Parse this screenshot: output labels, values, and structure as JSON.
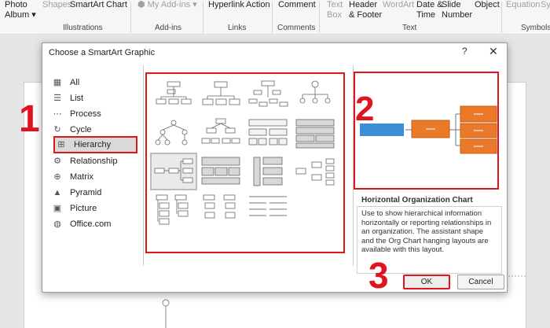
{
  "ribbon": {
    "items": [
      {
        "label": "Photo\nAlbum ▾",
        "dim": false
      },
      {
        "label": "Shapes",
        "dim": true
      },
      {
        "label": "SmartArt",
        "dim": false
      },
      {
        "label": "Chart",
        "dim": false
      },
      {
        "label": "My Add-ins ▾",
        "dim": true
      },
      {
        "label": "Hyperlink",
        "dim": false
      },
      {
        "label": "Action",
        "dim": false
      },
      {
        "label": "Comment",
        "dim": false
      },
      {
        "label": "Text\nBox",
        "dim": true
      },
      {
        "label": "Header\n& Footer",
        "dim": false
      },
      {
        "label": "WordArt",
        "dim": true
      },
      {
        "label": "Date &\nTime",
        "dim": false
      },
      {
        "label": "Slide\nNumber",
        "dim": false
      },
      {
        "label": "Object",
        "dim": false
      },
      {
        "label": "Equation",
        "dim": true
      },
      {
        "label": "Sy",
        "dim": true
      }
    ],
    "groups": [
      "Illustrations",
      "Add-ins",
      "Links",
      "Comments",
      "Text",
      "Symbols"
    ]
  },
  "dialog": {
    "title": "Choose a SmartArt Graphic",
    "help": "?",
    "close": "✕",
    "categories": [
      {
        "label": "All",
        "icon": "all-icon"
      },
      {
        "label": "List",
        "icon": "list-icon"
      },
      {
        "label": "Process",
        "icon": "process-icon"
      },
      {
        "label": "Cycle",
        "icon": "cycle-icon"
      },
      {
        "label": "Hierarchy",
        "icon": "hierarchy-icon"
      },
      {
        "label": "Relationship",
        "icon": "relationship-icon"
      },
      {
        "label": "Matrix",
        "icon": "matrix-icon"
      },
      {
        "label": "Pyramid",
        "icon": "pyramid-icon"
      },
      {
        "label": "Picture",
        "icon": "picture-icon"
      },
      {
        "label": "Office.com",
        "icon": "globe-icon"
      }
    ],
    "selected_category": "Hierarchy",
    "layout_name": "Horizontal Organization Chart",
    "layout_description": "Use to show hierarchical information horizontally or reporting relationships in an organization. The assistant shape and the Org Chart hanging layouts are available with this layout.",
    "ok_label": "OK",
    "cancel_label": "Cancel"
  },
  "steps": [
    "1",
    "2",
    "3"
  ],
  "colors": {
    "highlight": "#e0141e",
    "shape_orange": "#ea7a2a",
    "shape_blue": "#3a8fd8"
  }
}
